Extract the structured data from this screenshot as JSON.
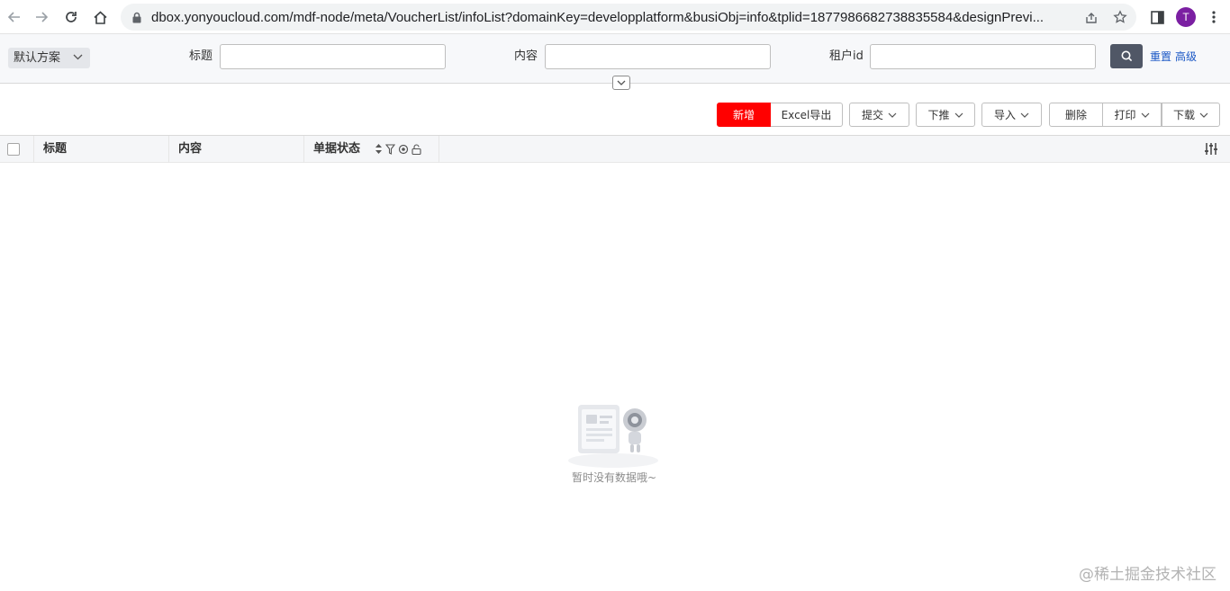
{
  "browser": {
    "url": "dbox.yonyoucloud.com/mdf-node/meta/VoucherList/infoList?domainKey=developplatform&busiObj=info&tplid=1877986682738835584&designPrevi...",
    "avatar_letter": "T",
    "avatar_color": "#7b1fa2"
  },
  "filter": {
    "scheme_label": "默认方案",
    "fields": [
      {
        "label": "标题",
        "value": ""
      },
      {
        "label": "内容",
        "value": ""
      },
      {
        "label": "租户id",
        "value": ""
      }
    ],
    "reset_label": "重置",
    "advanced_label": "高级"
  },
  "toolbar": {
    "add_label": "新增",
    "excel_export_label": "Excel导出",
    "submit_label": "提交",
    "push_down_label": "下推",
    "import_label": "导入",
    "delete_label": "删除",
    "print_label": "打印",
    "download_label": "下载",
    "accent_color": "#ff0000"
  },
  "table": {
    "columns": [
      "标题",
      "内容",
      "单据状态"
    ]
  },
  "empty_state": {
    "text": "暂时没有数据哦~"
  },
  "watermark": "@稀土掘金技术社区"
}
